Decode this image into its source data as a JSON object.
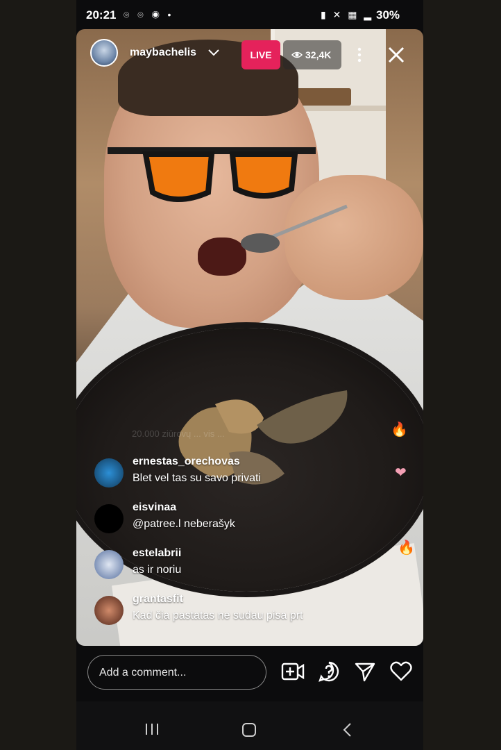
{
  "status_bar": {
    "time": "20:21",
    "notifications": "⌾ ⌾ ◉ •",
    "system_icons": "▮ ✕ ▦ ▂",
    "battery": "30%"
  },
  "header": {
    "username": "maybachelis",
    "live_label": "LIVE",
    "viewer_count": "32,4K"
  },
  "faded_text": "20.000 ziūrovų ... vis ...",
  "comments": [
    {
      "user": "ernestas_orechovas",
      "text": "Blet vel tas su savo privati",
      "avatar_color": "#1c5b8a"
    },
    {
      "user": "eisvinaa",
      "text": "@patree.l neberašyk",
      "avatar_color": "#000000"
    },
    {
      "user": "estelabrii",
      "text": "as ir noriu",
      "avatar_color": "#7f93b8"
    },
    {
      "user": "grantasfit",
      "text": "Kad čia pastatas ne sudau pisa prt",
      "avatar_color": "#8a4b3a"
    }
  ],
  "reactions": [
    "🔥",
    "❤",
    "🔥"
  ],
  "bottom_bar": {
    "comment_placeholder": "Add a comment..."
  },
  "nav_bar": {
    "recents_icon": "recents-icon",
    "home_icon": "home-icon",
    "back_icon": "back-icon"
  },
  "colors": {
    "live_red": "#e5225b",
    "background": "#0c0c0d"
  }
}
